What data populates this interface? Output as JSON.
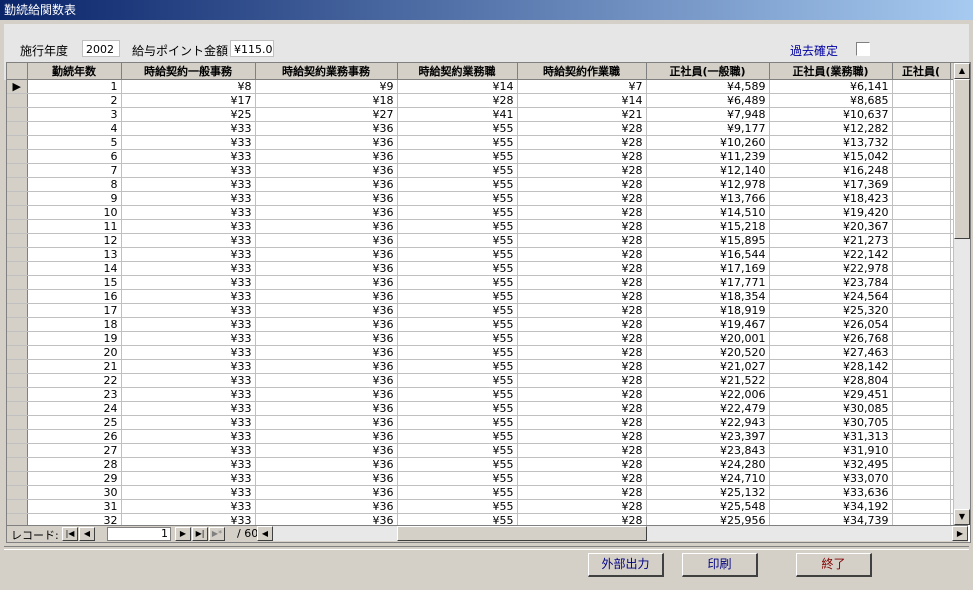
{
  "window": {
    "title": "勤続給関数表"
  },
  "header": {
    "year_label": "施行年度",
    "year_value": "2002",
    "point_label": "給与ポイント金額",
    "point_value": "¥115.0",
    "kakutei_label": "過去確定"
  },
  "grid": {
    "columns": [
      "勤続年数",
      "時給契約一般事務",
      "時給契約業務事務",
      "時給契約業務職",
      "時給契約作業職",
      "正社員(一般職)",
      "正社員(業務職)",
      "正社員("
    ],
    "rows": [
      [
        "1",
        "¥8",
        "¥9",
        "¥14",
        "¥7",
        "¥4,589",
        "¥6,141",
        ""
      ],
      [
        "2",
        "¥17",
        "¥18",
        "¥28",
        "¥14",
        "¥6,489",
        "¥8,685",
        ""
      ],
      [
        "3",
        "¥25",
        "¥27",
        "¥41",
        "¥21",
        "¥7,948",
        "¥10,637",
        ""
      ],
      [
        "4",
        "¥33",
        "¥36",
        "¥55",
        "¥28",
        "¥9,177",
        "¥12,282",
        ""
      ],
      [
        "5",
        "¥33",
        "¥36",
        "¥55",
        "¥28",
        "¥10,260",
        "¥13,732",
        ""
      ],
      [
        "6",
        "¥33",
        "¥36",
        "¥55",
        "¥28",
        "¥11,239",
        "¥15,042",
        ""
      ],
      [
        "7",
        "¥33",
        "¥36",
        "¥55",
        "¥28",
        "¥12,140",
        "¥16,248",
        ""
      ],
      [
        "8",
        "¥33",
        "¥36",
        "¥55",
        "¥28",
        "¥12,978",
        "¥17,369",
        ""
      ],
      [
        "9",
        "¥33",
        "¥36",
        "¥55",
        "¥28",
        "¥13,766",
        "¥18,423",
        ""
      ],
      [
        "10",
        "¥33",
        "¥36",
        "¥55",
        "¥28",
        "¥14,510",
        "¥19,420",
        ""
      ],
      [
        "11",
        "¥33",
        "¥36",
        "¥55",
        "¥28",
        "¥15,218",
        "¥20,367",
        ""
      ],
      [
        "12",
        "¥33",
        "¥36",
        "¥55",
        "¥28",
        "¥15,895",
        "¥21,273",
        ""
      ],
      [
        "13",
        "¥33",
        "¥36",
        "¥55",
        "¥28",
        "¥16,544",
        "¥22,142",
        ""
      ],
      [
        "14",
        "¥33",
        "¥36",
        "¥55",
        "¥28",
        "¥17,169",
        "¥22,978",
        ""
      ],
      [
        "15",
        "¥33",
        "¥36",
        "¥55",
        "¥28",
        "¥17,771",
        "¥23,784",
        ""
      ],
      [
        "16",
        "¥33",
        "¥36",
        "¥55",
        "¥28",
        "¥18,354",
        "¥24,564",
        ""
      ],
      [
        "17",
        "¥33",
        "¥36",
        "¥55",
        "¥28",
        "¥18,919",
        "¥25,320",
        ""
      ],
      [
        "18",
        "¥33",
        "¥36",
        "¥55",
        "¥28",
        "¥19,467",
        "¥26,054",
        ""
      ],
      [
        "19",
        "¥33",
        "¥36",
        "¥55",
        "¥28",
        "¥20,001",
        "¥26,768",
        ""
      ],
      [
        "20",
        "¥33",
        "¥36",
        "¥55",
        "¥28",
        "¥20,520",
        "¥27,463",
        ""
      ],
      [
        "21",
        "¥33",
        "¥36",
        "¥55",
        "¥28",
        "¥21,027",
        "¥28,142",
        ""
      ],
      [
        "22",
        "¥33",
        "¥36",
        "¥55",
        "¥28",
        "¥21,522",
        "¥28,804",
        ""
      ],
      [
        "23",
        "¥33",
        "¥36",
        "¥55",
        "¥28",
        "¥22,006",
        "¥29,451",
        ""
      ],
      [
        "24",
        "¥33",
        "¥36",
        "¥55",
        "¥28",
        "¥22,479",
        "¥30,085",
        ""
      ],
      [
        "25",
        "¥33",
        "¥36",
        "¥55",
        "¥28",
        "¥22,943",
        "¥30,705",
        ""
      ],
      [
        "26",
        "¥33",
        "¥36",
        "¥55",
        "¥28",
        "¥23,397",
        "¥31,313",
        ""
      ],
      [
        "27",
        "¥33",
        "¥36",
        "¥55",
        "¥28",
        "¥23,843",
        "¥31,910",
        ""
      ],
      [
        "28",
        "¥33",
        "¥36",
        "¥55",
        "¥28",
        "¥24,280",
        "¥32,495",
        ""
      ],
      [
        "29",
        "¥33",
        "¥36",
        "¥55",
        "¥28",
        "¥24,710",
        "¥33,070",
        ""
      ],
      [
        "30",
        "¥33",
        "¥36",
        "¥55",
        "¥28",
        "¥25,132",
        "¥33,636",
        ""
      ],
      [
        "31",
        "¥33",
        "¥36",
        "¥55",
        "¥28",
        "¥25,548",
        "¥34,192",
        ""
      ],
      [
        "32",
        "¥33",
        "¥36",
        "¥55",
        "¥28",
        "¥25,956",
        "¥34,739",
        ""
      ]
    ]
  },
  "navigation": {
    "record_label": "レコード:",
    "current": "1",
    "total": "/ 60"
  },
  "buttons": {
    "export": "外部出力",
    "print": "印刷",
    "exit": "終了"
  },
  "colors": {
    "title_start": "#0a246a",
    "title_end": "#a6caf0",
    "link": "#0000a0",
    "exit_text": "#800000"
  }
}
